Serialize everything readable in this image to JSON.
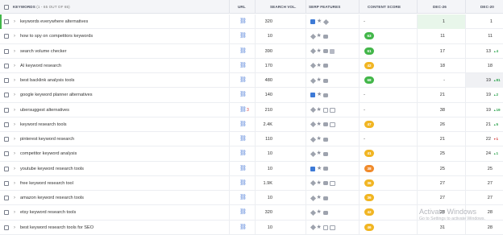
{
  "header": {
    "keywords": "KEYWORDS",
    "count": "(1 - 65 OUT OF 65)",
    "url": "URL",
    "search_vol": "SEARCH VOL.",
    "serp": "SERP FEATURES",
    "content_score": "CONTENT SCORE",
    "dec26": "DEC-26",
    "dec20": "DEC-20"
  },
  "colors": {
    "score_green": "#42b649",
    "score_yellow": "#f1b522",
    "score_orange": "#f08a2b",
    "link_blue": "#4a7ad6"
  },
  "rows": [
    {
      "keyword": "keywords everywhere alternatives",
      "url_count": "",
      "vol": "320",
      "serp": [
        "sq",
        "star",
        "diamond"
      ],
      "score": "-",
      "score_color": "",
      "dec26": "1",
      "dec20": "1",
      "delta": "",
      "delta_dir": "",
      "hl26": true,
      "hl20": false
    },
    {
      "keyword": "how to spy on competitors keywords",
      "url_count": "",
      "vol": "10",
      "serp": [
        "diamond",
        "star",
        "video"
      ],
      "score": "63",
      "score_color": "#42b649",
      "dec26": "11",
      "dec20": "11",
      "delta": "",
      "delta_dir": "",
      "hl26": false,
      "hl20": false
    },
    {
      "keyword": "search volume checker",
      "url_count": "",
      "vol": "390",
      "serp": [
        "diamond",
        "star",
        "video",
        "sq-grey"
      ],
      "score": "61",
      "score_color": "#42b649",
      "dec26": "17",
      "dec20": "13",
      "delta": "4",
      "delta_dir": "up",
      "hl26": false,
      "hl20": false
    },
    {
      "keyword": "AI keyword research",
      "url_count": "",
      "vol": "170",
      "serp": [
        "diamond",
        "star",
        "video"
      ],
      "score": "42",
      "score_color": "#f1b522",
      "dec26": "18",
      "dec20": "18",
      "delta": "",
      "delta_dir": "",
      "hl26": false,
      "hl20": false
    },
    {
      "keyword": "best backlink analysis tools",
      "url_count": "",
      "vol": "480",
      "serp": [
        "diamond",
        "star",
        "video"
      ],
      "score": "68",
      "score_color": "#42b649",
      "dec26": "-",
      "dec20": "19",
      "delta": "81",
      "delta_dir": "up",
      "hl26": false,
      "hl20": true
    },
    {
      "keyword": "google keyword planner alternatives",
      "url_count": "",
      "vol": "140",
      "serp": [
        "sq",
        "star",
        "video"
      ],
      "score": "-",
      "score_color": "",
      "dec26": "21",
      "dec20": "19",
      "delta": "2",
      "delta_dir": "up",
      "hl26": false,
      "hl20": false
    },
    {
      "keyword": "ubersuggest alternatives",
      "url_count": "3",
      "vol": "210",
      "serp": [
        "diamond",
        "star",
        "img",
        "img2"
      ],
      "score": "-",
      "score_color": "",
      "dec26": "38",
      "dec20": "19",
      "delta": "19",
      "delta_dir": "up",
      "hl26": false,
      "hl20": false
    },
    {
      "keyword": "keyword research tools",
      "url_count": "",
      "vol": "2.4K",
      "serp": [
        "diamond",
        "star",
        "video",
        "img2"
      ],
      "score": "47",
      "score_color": "#f1b522",
      "dec26": "26",
      "dec20": "21",
      "delta": "5",
      "delta_dir": "up",
      "hl26": false,
      "hl20": false
    },
    {
      "keyword": "pinterest keyword research",
      "url_count": "",
      "vol": "110",
      "serp": [
        "diamond",
        "star",
        "video"
      ],
      "score": "-",
      "score_color": "",
      "dec26": "21",
      "dec20": "22",
      "delta": "1",
      "delta_dir": "down",
      "hl26": false,
      "hl20": false
    },
    {
      "keyword": "competitor keyword analysis",
      "url_count": "",
      "vol": "10",
      "serp": [
        "diamond",
        "star",
        "video"
      ],
      "score": "41",
      "score_color": "#f1b522",
      "dec26": "25",
      "dec20": "24",
      "delta": "1",
      "delta_dir": "up",
      "hl26": false,
      "hl20": false
    },
    {
      "keyword": "youtube keyword research tools",
      "url_count": "",
      "vol": "10",
      "serp": [
        "sq",
        "star",
        "video"
      ],
      "score": "38",
      "score_color": "#f08a2b",
      "dec26": "25",
      "dec20": "25",
      "delta": "",
      "delta_dir": "",
      "hl26": false,
      "hl20": false
    },
    {
      "keyword": "free keyword research tool",
      "url_count": "",
      "vol": "1.9K",
      "serp": [
        "diamond",
        "star",
        "video",
        "img2"
      ],
      "score": "36",
      "score_color": "#f1b522",
      "dec26": "27",
      "dec20": "27",
      "delta": "",
      "delta_dir": "",
      "hl26": false,
      "hl20": false
    },
    {
      "keyword": "amazon keyword research tools",
      "url_count": "",
      "vol": "10",
      "serp": [
        "diamond",
        "star",
        "video"
      ],
      "score": "36",
      "score_color": "#f1b522",
      "dec26": "27",
      "dec20": "27",
      "delta": "",
      "delta_dir": "",
      "hl26": false,
      "hl20": false
    },
    {
      "keyword": "etsy keyword research tools",
      "url_count": "",
      "vol": "320",
      "serp": [
        "diamond",
        "star",
        "video"
      ],
      "score": "42",
      "score_color": "#f1b522",
      "dec26": "28",
      "dec20": "28",
      "delta": "",
      "delta_dir": "",
      "hl26": false,
      "hl20": false
    },
    {
      "keyword": "best keyword research tools for SEO",
      "url_count": "",
      "vol": "10",
      "serp": [
        "diamond",
        "star",
        "img",
        "img2"
      ],
      "score": "46",
      "score_color": "#f1b522",
      "dec26": "31",
      "dec20": "28",
      "delta": "",
      "delta_dir": "",
      "hl26": false,
      "hl20": false
    }
  ],
  "watermark": {
    "title": "Activate Windows",
    "subtitle": "Go to Settings to activate Windows."
  }
}
